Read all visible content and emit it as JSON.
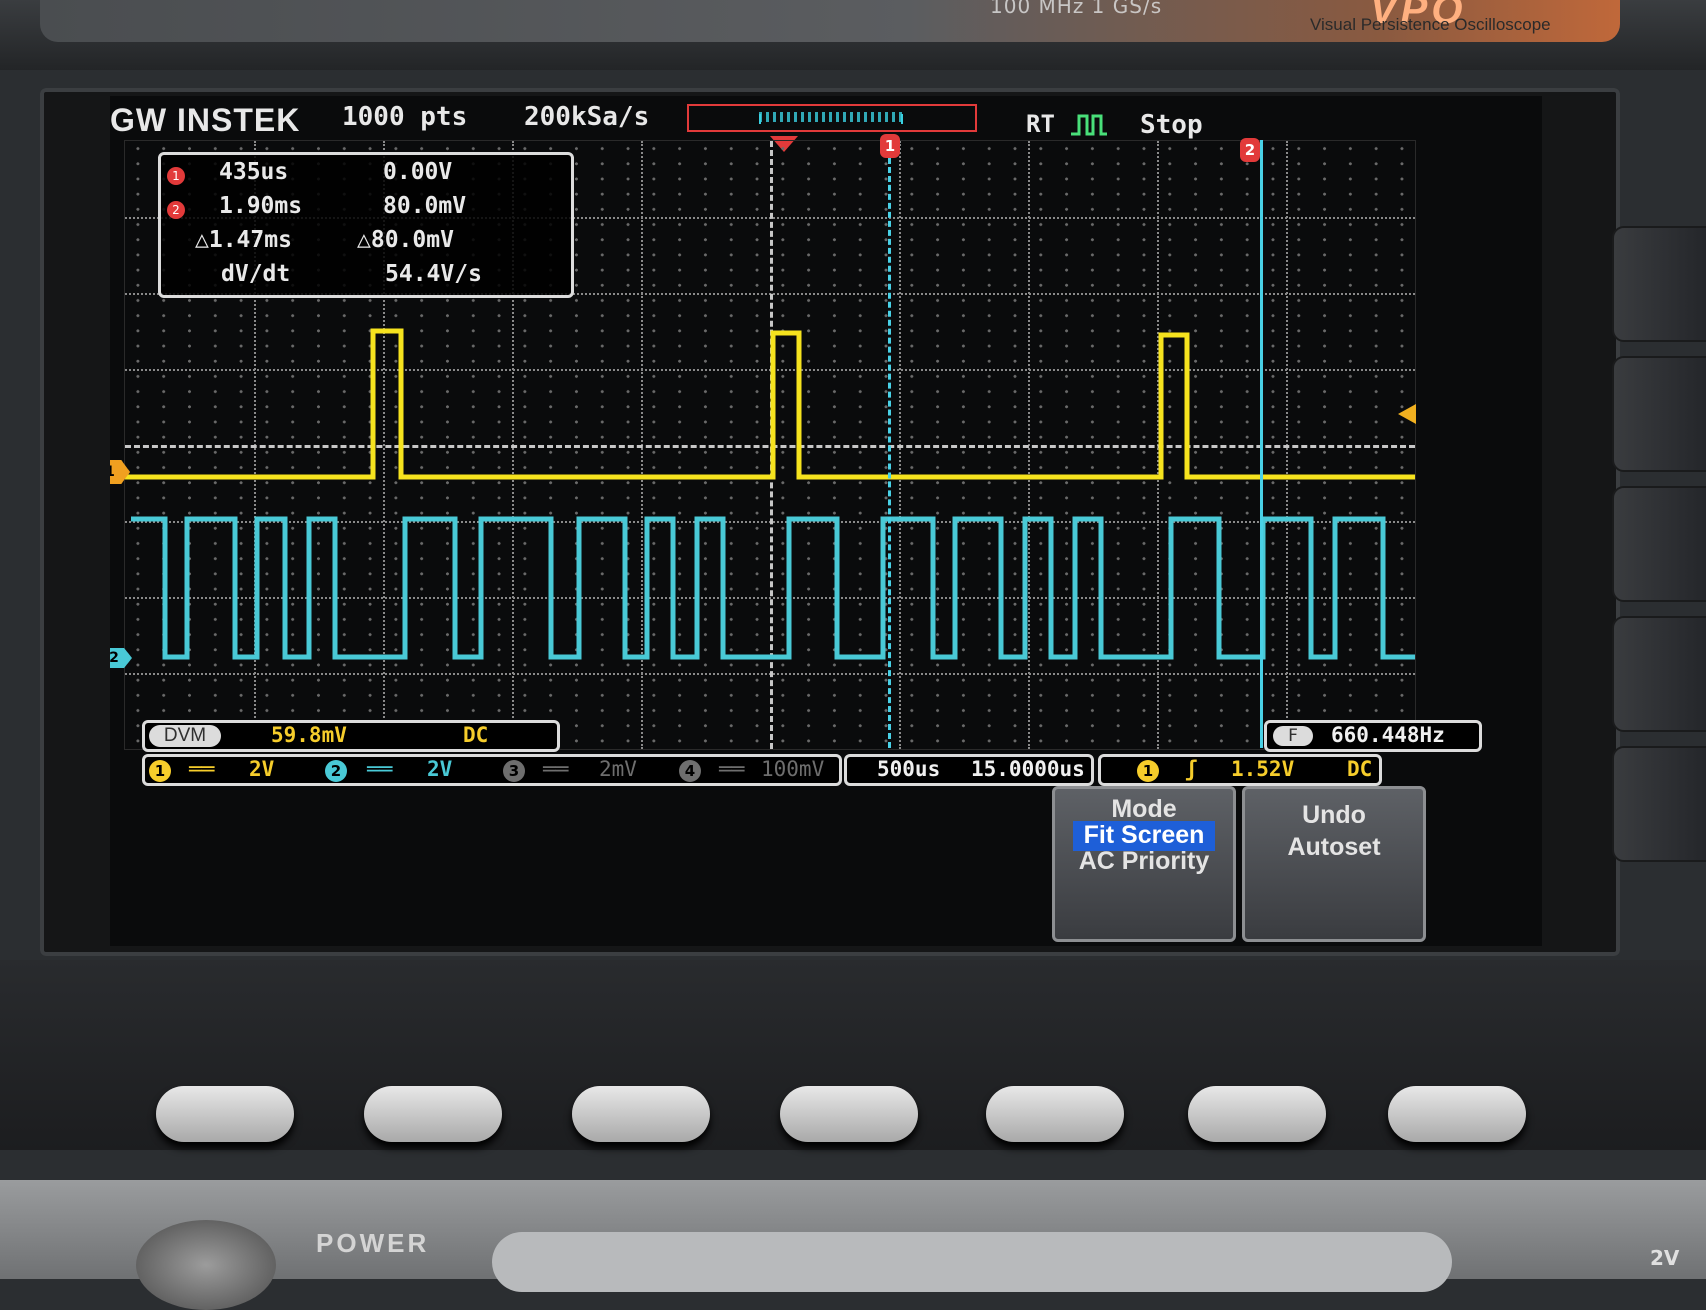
{
  "device": {
    "top_specs": "100 MHz    1 GS/s",
    "series_logo": "VPO",
    "tagline": "Visual Persistence Oscilloscope",
    "power_label": "POWER",
    "corner_label": "2V"
  },
  "header": {
    "brand": "GW INSTEK",
    "record_length": "1000 pts",
    "sample_rate": "200kSa/s",
    "acq_mode": "RT",
    "run_state": "Stop"
  },
  "cursors": {
    "c1_label": "1",
    "c2_label": "2",
    "rows": [
      {
        "marker": "1",
        "time": "435us",
        "value": "0.00V"
      },
      {
        "marker": "2",
        "time": "1.90ms",
        "value": "80.0mV"
      },
      {
        "marker": "",
        "time": "△1.47ms",
        "value": "△80.0mV"
      },
      {
        "marker": "",
        "time": "dV/dt",
        "value": "54.4V/s"
      }
    ]
  },
  "channels": {
    "ch1_marker": "1",
    "ch2_marker": "2",
    "ch1_color": "#f6e31e",
    "ch2_color": "#49c9d6",
    "ch1_pulses_x": [
      262,
      661,
      1049
    ],
    "ch2_period_divisions": "digital bit pattern"
  },
  "dvm": {
    "label": "DVM",
    "value": "59.8mV",
    "coupling": "DC"
  },
  "frequency": {
    "label": "F",
    "value": "660.448Hz"
  },
  "vertical": [
    {
      "num": "1",
      "coupling": "══",
      "scale": "2V",
      "color": "#f6cd2b"
    },
    {
      "num": "2",
      "coupling": "══",
      "scale": "2V",
      "color": "#49c9d6"
    },
    {
      "num": "3",
      "coupling": "══",
      "scale": "2mV",
      "color": "#6e6e6e"
    },
    {
      "num": "4",
      "coupling": "══",
      "scale": "100mV",
      "color": "#6e6e6e"
    }
  ],
  "timebase": {
    "scale": "500us",
    "position": "15.0000us"
  },
  "trigger": {
    "source": "1",
    "slope": "ʃ",
    "level": "1.52V",
    "coupling": "DC"
  },
  "menu": {
    "mode_title": "Mode",
    "mode_selected": "Fit Screen",
    "mode_other": "AC Priority",
    "undo_line1": "Undo",
    "undo_line2": "Autoset"
  }
}
